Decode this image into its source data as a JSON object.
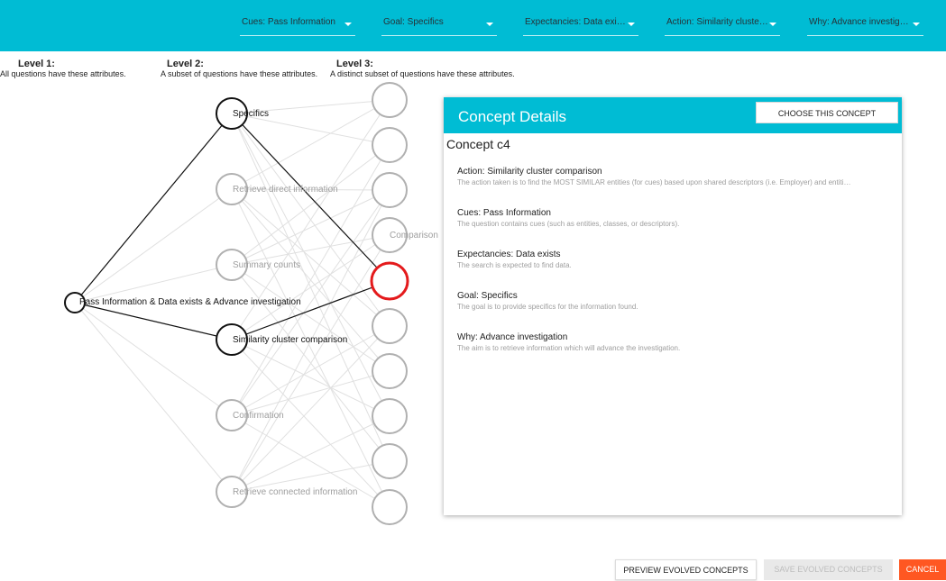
{
  "filters": [
    {
      "label": "Cues: Pass Information"
    },
    {
      "label": "Goal: Specifics"
    },
    {
      "label": "Expectancies: Data exi…"
    },
    {
      "label": "Action: Similarity cluste…"
    },
    {
      "label": "Why: Advance investig…"
    }
  ],
  "levels": [
    {
      "title": "Level 1:",
      "subtitle": "All questions have these attributes."
    },
    {
      "title": "Level 2:",
      "subtitle": "A subset of questions have these attributes."
    },
    {
      "title": "Level 3:",
      "subtitle": "A distinct subset of questions have these attributes."
    }
  ],
  "graph": {
    "root": {
      "label": "Pass Information & Data exists & Advance investigation",
      "active": true
    },
    "level2": [
      {
        "label": "Specifics",
        "active": true
      },
      {
        "label": "Retrieve direct information",
        "active": false
      },
      {
        "label": "Summary counts",
        "active": false
      },
      {
        "label": "Similarity cluster comparison",
        "active": true
      },
      {
        "label": "Confirmation",
        "active": false
      },
      {
        "label": "Retrieve connected information",
        "active": false
      }
    ],
    "level3": [
      {
        "label": "",
        "state": "inactive"
      },
      {
        "label": "",
        "state": "inactive"
      },
      {
        "label": "",
        "state": "inactive"
      },
      {
        "label": "Comparison",
        "state": "inactive"
      },
      {
        "label": "",
        "state": "selected"
      },
      {
        "label": "",
        "state": "inactive"
      },
      {
        "label": "",
        "state": "inactive"
      },
      {
        "label": "",
        "state": "inactive"
      },
      {
        "label": "",
        "state": "inactive"
      },
      {
        "label": "",
        "state": "inactive"
      }
    ]
  },
  "panel": {
    "title": "Concept Details",
    "choose_label": "CHOOSE THIS CONCEPT",
    "concept_name": "Concept c4",
    "attributes": [
      {
        "heading": "Action: Similarity cluster comparison",
        "desc": "The action taken is to find the MOST SIMILAR entities (for cues) based upon shared descriptors (i.e. Employer) and entiti…"
      },
      {
        "heading": "Cues: Pass Information",
        "desc": "The question contains cues (such as entities, classes, or descriptors)."
      },
      {
        "heading": "Expectancies: Data exists",
        "desc": "The search is expected to find data."
      },
      {
        "heading": "Goal: Specifics",
        "desc": "The goal is to provide specifics for the information found."
      },
      {
        "heading": "Why: Advance investigation",
        "desc": "The aim is to retrieve information which will advance the investigation."
      }
    ]
  },
  "actions": {
    "preview": "PREVIEW EVOLVED CONCEPTS",
    "save": "SAVE EVOLVED CONCEPTS",
    "cancel": "CANCEL"
  },
  "colors": {
    "accent": "#00BCD4",
    "selected": "#e41a1c",
    "cancel": "#FF5722"
  }
}
